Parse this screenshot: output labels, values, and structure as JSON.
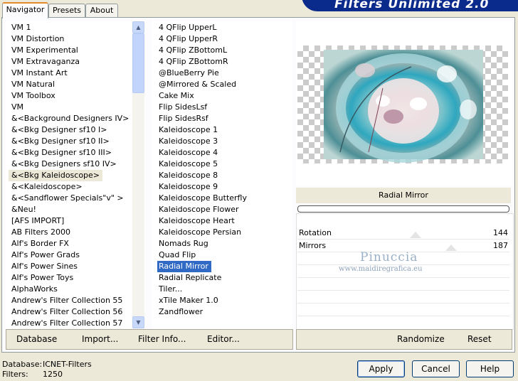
{
  "app": {
    "title": "Filters Unlimited 2.0"
  },
  "tabs": [
    {
      "label": "Navigator"
    },
    {
      "label": "Presets"
    },
    {
      "label": "About"
    }
  ],
  "categories": {
    "items": [
      "VM 1",
      "VM Distortion",
      "VM Experimental",
      "VM Extravaganza",
      "VM Instant Art",
      "VM Natural",
      "VM Toolbox",
      "VM",
      "&<Background Designers IV>",
      "&<Bkg Designer sf10 I>",
      "&<Bkg Designer sf10 II>",
      "&<Bkg Designer sf10 III>",
      "&<Bkg Designers sf10 IV>",
      "&<Bkg Kaleidoscope>",
      "&<Kaleidoscope>",
      "&<Sandflower Specials\"v\" >",
      "&Neu!",
      "[AFS IMPORT]",
      "AB Filters 2000",
      "Alf's Border FX",
      "Alf's Power Grads",
      "Alf's Power Sines",
      "Alf's Power Toys",
      "AlphaWorks",
      "Andrew's Filter Collection 55",
      "Andrew's Filter Collection 56",
      "Andrew's Filter Collection 57"
    ],
    "selected": "&<Bkg Kaleidoscope>"
  },
  "filters": {
    "items": [
      "4 QFlip UpperL",
      "4 QFlip UpperR",
      "4 QFlip ZBottomL",
      "4 QFlip ZBottomR",
      "@BlueBerry Pie",
      "@Mirrored & Scaled",
      "Cake Mix",
      "Flip SidesLsf",
      "Flip SidesRsf",
      "Kaleidoscope 1",
      "Kaleidoscope 3",
      "Kaleidoscope 4",
      "Kaleidoscope 5",
      "Kaleidoscope 8",
      "Kaleidoscope 9",
      "Kaleidoscope Butterfly",
      "Kaleidoscope Flower",
      "Kaleidoscope Heart",
      "Kaleidoscope Persian",
      "Nomads Rug",
      "Quad Flip",
      "Radial Mirror",
      "Radial Replicate",
      "Tiler...",
      "xTile Maker 1.0",
      "Zandflower"
    ],
    "selected": "Radial Mirror"
  },
  "preview": {
    "filter_name": "Radial Mirror",
    "params": [
      {
        "label": "Rotation",
        "value": "144"
      },
      {
        "label": "Mirrors",
        "value": "187"
      }
    ],
    "watermark_name": "Pinuccia",
    "watermark_url": "www.maidiregrafica.eu"
  },
  "left_bar": {
    "database": "Database",
    "import": "Import...",
    "filter_info": "Filter Info...",
    "editor": "Editor..."
  },
  "right_bar": {
    "randomize": "Randomize",
    "reset": "Reset"
  },
  "status": {
    "database_label": "Database:",
    "database_value": "ICNET-Filters",
    "filters_label": "Filters:",
    "filters_value": "1250"
  },
  "buttons": {
    "apply": "Apply",
    "cancel": "Cancel",
    "help": "Help"
  },
  "colors": {
    "selection": "#316ac5",
    "banner": "#0a2a8c",
    "tab_accent": "#e68b2c"
  }
}
